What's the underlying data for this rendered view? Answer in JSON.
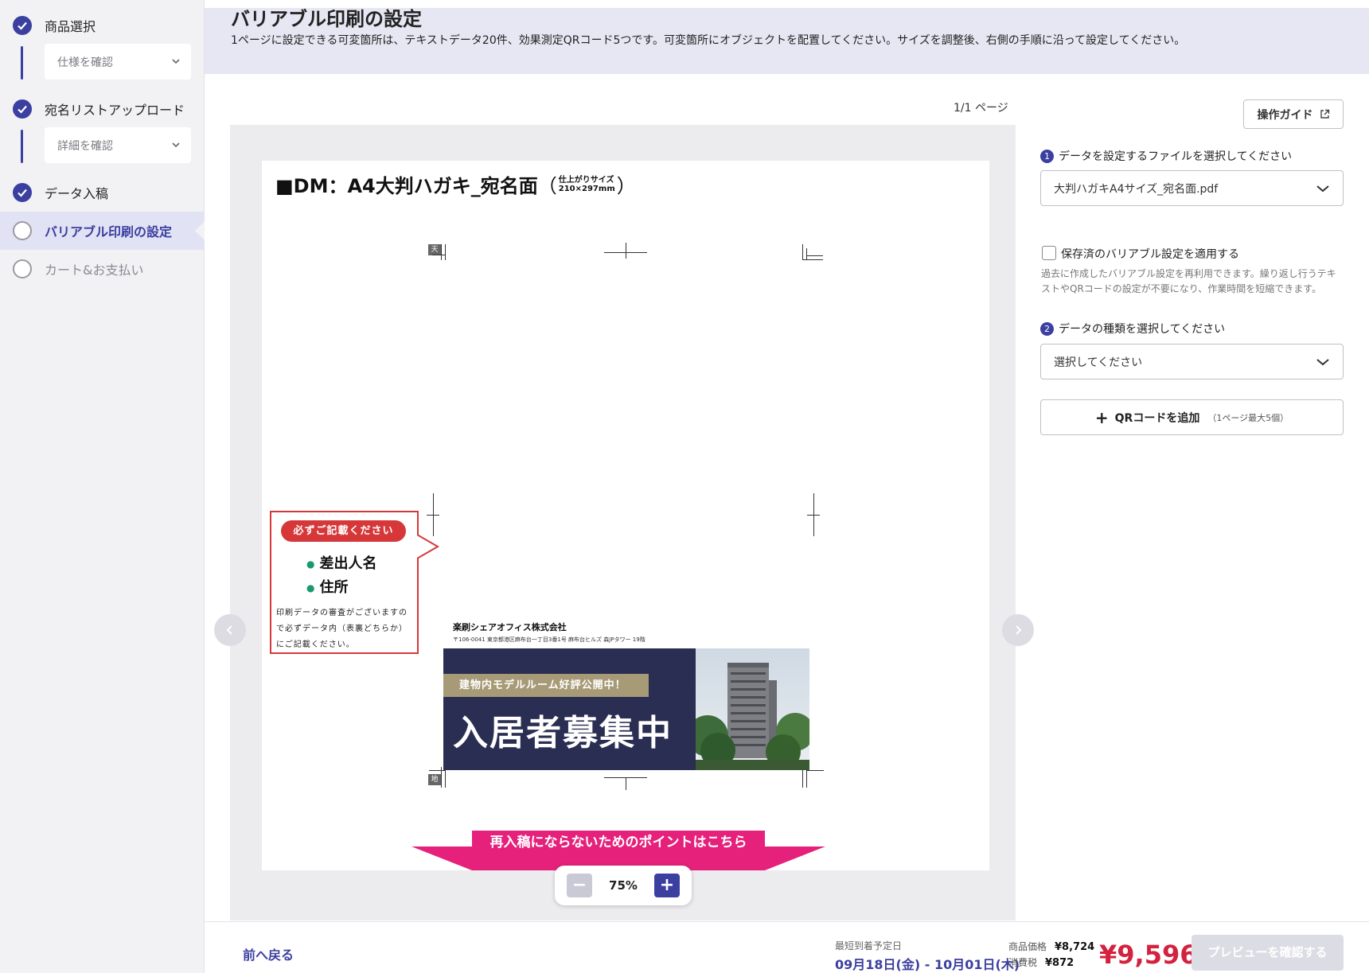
{
  "sidebar": {
    "steps": [
      {
        "label": "商品選択",
        "status": "done"
      },
      {
        "label": "宛名リストアップロード",
        "status": "done"
      },
      {
        "label": "データ入稿",
        "status": "done"
      },
      {
        "label": "バリアブル印刷の設定",
        "status": "current"
      },
      {
        "label": "カート&お支払い",
        "status": "todo"
      }
    ],
    "sub_spec": "仕様を確認",
    "sub_detail": "詳細を確認"
  },
  "header": {
    "title": "バリアブル印刷の設定",
    "description": "1ページに設定できる可変箇所は、テキストデータ20件、効果測定QRコード5つです。可変箇所にオブジェクトを配置してください。サイズを調整後、右側の手順に沿って設定してください。"
  },
  "canvas": {
    "page_counter": "1/1 ページ",
    "sheet_title_main": "■DM：A4大判ハガキ_宛名面",
    "sheet_title_small_1": "仕上がりサイズ",
    "sheet_title_small_2": "210×297mm",
    "mark_top": "天",
    "mark_bottom": "地",
    "note_pill": "必ずご記載ください",
    "note_item_1": "差出人名",
    "note_item_2": "住所",
    "note_text": "印刷データの審査がございますので必ずデータ内（表裏どちらか）にご記載ください。",
    "sender_company": "楽刷シェアオフィス株式会社",
    "sender_address": "〒106-0041 東京都港区麻布台一丁目3番1号 麻布台ヒルズ 森JPタワー 19階",
    "banner_tag": "建物内モデルルーム好評公開中！",
    "banner_headline": "入居者募集中",
    "pink_banner": "再入稿にならないためのポイントはこちら",
    "zoom_minus": "−",
    "zoom_value": "75%",
    "zoom_plus": "+"
  },
  "panel": {
    "guide_button": "操作ガイド",
    "step1_num": "1",
    "step1_label": "データを設定するファイルを選択してください",
    "file_select": "大判ハガキA4サイズ_宛名面.pdf",
    "saved_checkbox_label": "保存済のバリアブル設定を適用する",
    "saved_help": "過去に作成したバリアブル設定を再利用できます。繰り返し行うテキストやQRコードの設定が不要になり、作業時間を短縮できます。",
    "step2_num": "2",
    "step2_label": "データの種類を選択してください",
    "type_select": "選択してください",
    "qr_button": "QRコードを追加",
    "qr_button_sub": "（1ページ最大5個）"
  },
  "footer": {
    "back": "前へ戻る",
    "eta_label": "最短到着予定日",
    "eta": "09月18日(金) - 10月01日(木)",
    "price_label": "商品価格",
    "price": "¥8,724",
    "tax_label": "消費税",
    "tax": "¥872",
    "total": "¥9,596",
    "preview_button": "プレビューを確認する"
  },
  "colors": {
    "accent": "#3b3fa0",
    "total_red": "#d3213e",
    "note_red": "#d6383a",
    "pink": "#e5217c",
    "banner_navy": "#2a2e52",
    "banner_gold": "#a79a76"
  }
}
